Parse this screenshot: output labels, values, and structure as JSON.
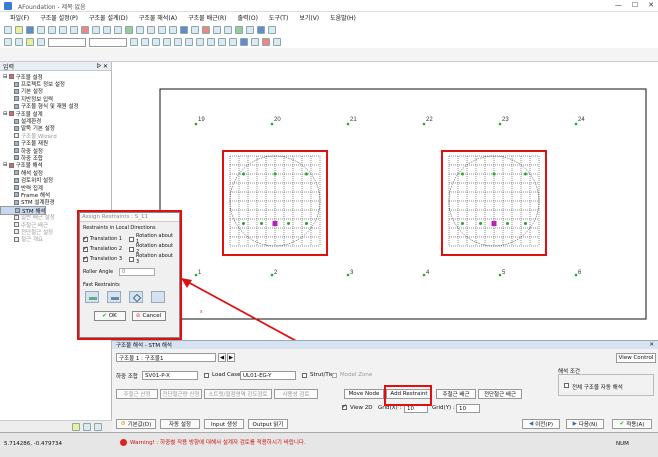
{
  "app_title": "AFoundation - 제목 없음",
  "menu": [
    "파일(F)",
    "구조물 설정(P)",
    "구조물 설계(D)",
    "구조물 해석(A)",
    "구조물 배근(R)",
    "출력(O)",
    "도구(T)",
    "보기(V)",
    "도움말(H)"
  ],
  "left_panel": {
    "header": "입력",
    "tree": [
      {
        "label": "구조물 설정",
        "level": 0,
        "dim": false
      },
      {
        "label": "프로젝트 정보 설정",
        "level": 1,
        "dim": false
      },
      {
        "label": "기본 설정",
        "level": 1,
        "dim": false
      },
      {
        "label": "지반정보 입력",
        "level": 1,
        "dim": false
      },
      {
        "label": "구조물 형식 및 재원 설정",
        "level": 1,
        "dim": false
      },
      {
        "label": "구조물 설계",
        "level": 0,
        "dim": false
      },
      {
        "label": "설계환경",
        "level": 1,
        "dim": false
      },
      {
        "label": "말뚝 기본 설정",
        "level": 1,
        "dim": false
      },
      {
        "label": "구조물 Wizard",
        "level": 1,
        "dim": true
      },
      {
        "label": "구조물 재원",
        "level": 1,
        "dim": false
      },
      {
        "label": "하중 설정",
        "level": 1,
        "dim": false
      },
      {
        "label": "하중 조합",
        "level": 1,
        "dim": false
      },
      {
        "label": "구조물 해석",
        "level": 0,
        "dim": false
      },
      {
        "label": "해석 설정",
        "level": 1,
        "dim": false
      },
      {
        "label": "검토위치 설정",
        "level": 1,
        "dim": false
      },
      {
        "label": "반력 집계",
        "level": 1,
        "dim": false
      },
      {
        "label": "Frame 해석",
        "level": 1,
        "dim": false
      },
      {
        "label": "STM 설계환경",
        "level": 1,
        "dim": false
      },
      {
        "label": "STM 해석",
        "level": 1,
        "dim": false,
        "selected": true
      },
      {
        "label": "구조물 배근",
        "level": 0,
        "dim": false
      },
      {
        "label": "일반 배근 설정",
        "level": 1,
        "dim": true
      },
      {
        "label": "주철근 배근",
        "level": 1,
        "dim": true
      },
      {
        "label": "전단철근 설정",
        "level": 1,
        "dim": true
      },
      {
        "label": "철근 개요",
        "level": 1,
        "dim": true
      }
    ]
  },
  "canvas": {
    "node_labels_top": [
      "19",
      "20",
      "21",
      "22",
      "23",
      "24"
    ],
    "node_labels_bottom": [
      "1",
      "2",
      "3",
      "4",
      "5",
      "6"
    ]
  },
  "dialog": {
    "title": "Assign Restraints : S_11",
    "group_label": "Restraints in Local Directions",
    "translations": [
      {
        "label": "Translation 1",
        "checked": true
      },
      {
        "label": "Translation 2",
        "checked": true
      },
      {
        "label": "Translation 3",
        "checked": true
      }
    ],
    "rotations": [
      {
        "label": "Rotation about 1",
        "checked": false
      },
      {
        "label": "Rotation about 2",
        "checked": false
      },
      {
        "label": "Rotation about 3",
        "checked": false
      }
    ],
    "roller_label": "Roller Angle",
    "roller_value": "0",
    "fast_label": "Fast Restraints",
    "ok": "OK",
    "cancel": "Cancel"
  },
  "bottom": {
    "title": "구조물 해석 - STM 해석",
    "struct_select": "구조물 1 : 구조물1",
    "view_control": "View Control",
    "load_combo_label": "하중 조합",
    "load_combo": "SV01-P-X",
    "load_case_label": "Load Case",
    "load_case": "UL01-EG-Y",
    "strut_tie": "Strut/Tie",
    "model_zone": "Model Zone",
    "row3": [
      "주철근 산정",
      "전단철근량 산정",
      "스트럿/절점영역 강도검토",
      "사용성 검토",
      "Move Node",
      "Add Restraint",
      "주철근 배근",
      "전단철근 배근"
    ],
    "view2d": "View 2D",
    "gridx_label": "Grid(X) :",
    "gridx": "10",
    "gridy_label": "Grid(Y) :",
    "gridy": "10",
    "analysis_cond": "해석 조건",
    "auto_analysis": "전체 구조물 자동 해석",
    "bottom_btns": [
      "기본값(D)",
      "자동 설정",
      "Input 생성",
      "Output 읽기"
    ],
    "prev": "이전(P)",
    "next": "다음(N)",
    "apply": "적용(A)"
  },
  "status": {
    "coords": "5.714286, -0.479734",
    "warning": "Warning! : 하중별 작용 방향에 대해서 설계자 검토를 적용하시기 바랍니다.",
    "num": "NUM"
  },
  "colors": {
    "highlight": "#dd1111",
    "dot_green": "#22aa22",
    "dot_magenta": "#bb22bb"
  }
}
